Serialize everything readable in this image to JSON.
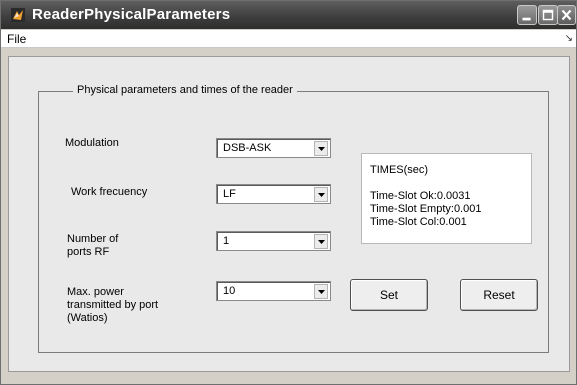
{
  "window": {
    "title": "ReaderPhysicalParameters",
    "controls": [
      "minimize-icon",
      "maximize-icon",
      "close-icon"
    ]
  },
  "menu": {
    "file": "File",
    "overflow_glyph": "↘"
  },
  "panel": {
    "title": "Physical parameters and times of the reader",
    "fields": [
      {
        "label_lines": [
          "Modulation"
        ],
        "value": "DSB-ASK"
      },
      {
        "label_lines": [
          "Work frecuency"
        ],
        "value": "LF"
      },
      {
        "label_lines": [
          "Number of",
          "ports RF"
        ],
        "value": "1"
      },
      {
        "label_lines": [
          "Max. power",
          "transmitted by port",
          "(Watios)"
        ],
        "value": "10"
      }
    ],
    "times": {
      "header": "TIMES(sec)",
      "lines": [
        "Time-Slot Ok:0.0031",
        "Time-Slot Empty:0.001",
        "Time-Slot Col:0.001"
      ]
    },
    "buttons": {
      "set": "Set",
      "reset": "Reset"
    }
  }
}
